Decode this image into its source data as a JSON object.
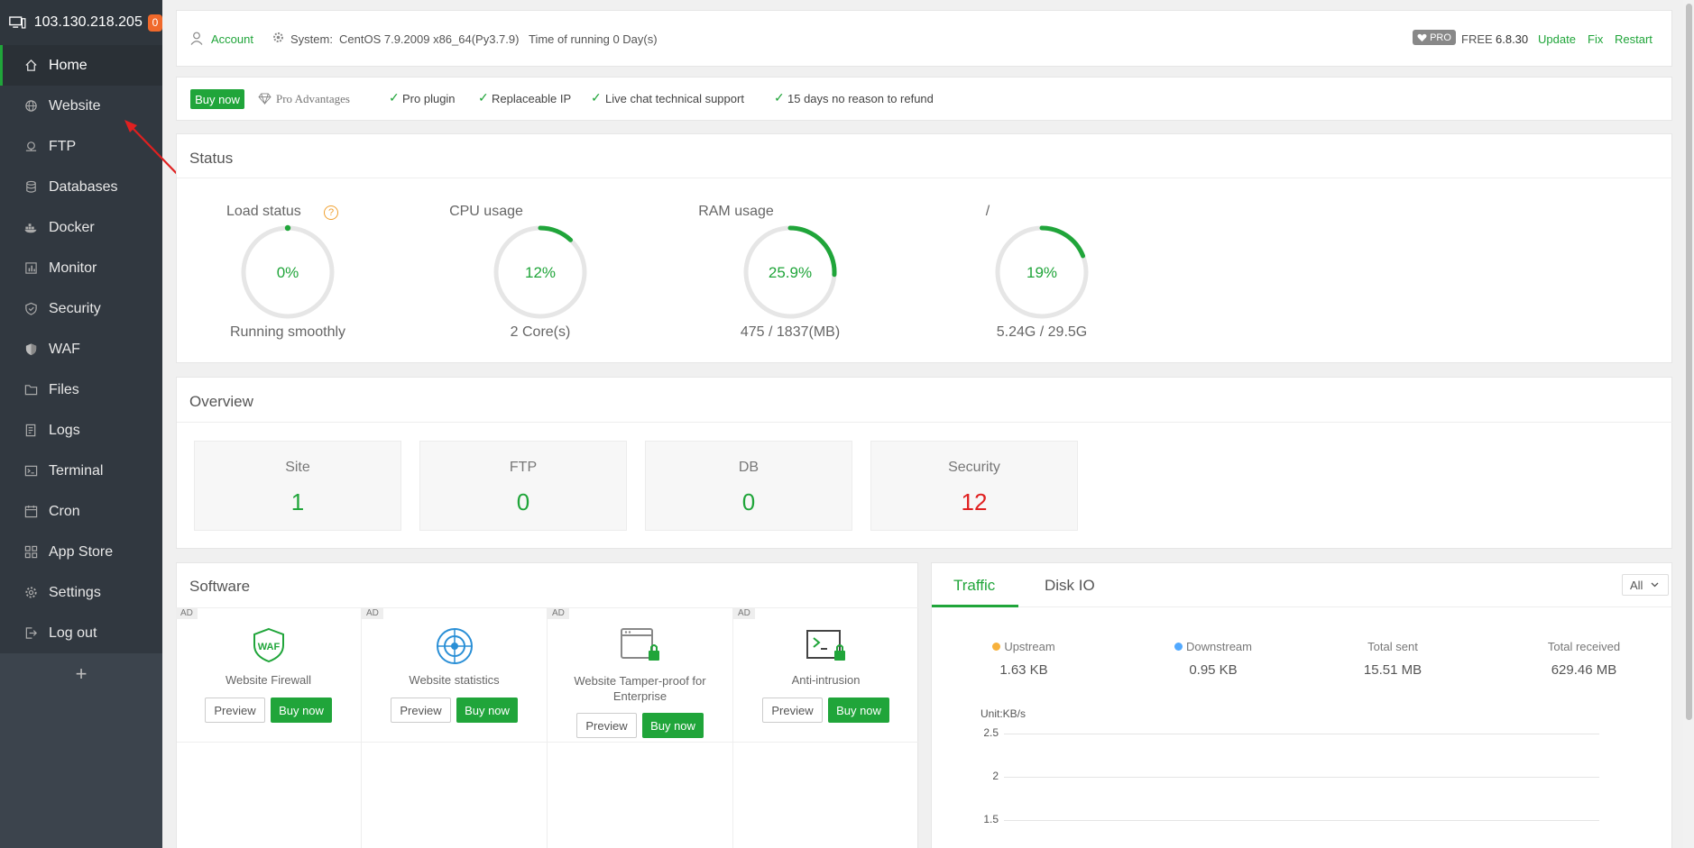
{
  "sidebar": {
    "ip": "103.130.218.205",
    "badge": "0",
    "items": [
      {
        "label": "Home",
        "icon": "home-icon"
      },
      {
        "label": "Website",
        "icon": "globe-icon"
      },
      {
        "label": "FTP",
        "icon": "ftp-icon"
      },
      {
        "label": "Databases",
        "icon": "database-icon"
      },
      {
        "label": "Docker",
        "icon": "docker-icon"
      },
      {
        "label": "Monitor",
        "icon": "monitor-icon"
      },
      {
        "label": "Security",
        "icon": "shield-icon"
      },
      {
        "label": "WAF",
        "icon": "waf-shield-icon"
      },
      {
        "label": "Files",
        "icon": "folder-icon"
      },
      {
        "label": "Logs",
        "icon": "logs-icon"
      },
      {
        "label": "Terminal",
        "icon": "terminal-icon"
      },
      {
        "label": "Cron",
        "icon": "calendar-icon"
      },
      {
        "label": "App Store",
        "icon": "grid-icon"
      },
      {
        "label": "Settings",
        "icon": "gear-icon"
      },
      {
        "label": "Log out",
        "icon": "logout-icon"
      }
    ],
    "plus": "+"
  },
  "topbar": {
    "account": "Account",
    "system_label": "System:",
    "system_value": "CentOS 7.9.2009 x86_64(Py3.7.9)",
    "running_time": "Time of running 0 Day(s)",
    "pro_badge": "PRO",
    "edition": "FREE",
    "version": "6.8.30",
    "update": "Update",
    "fix": "Fix",
    "restart": "Restart"
  },
  "promo": {
    "buy_now": "Buy now",
    "pro_advantages": "Pro Advantages",
    "features": [
      "Pro plugin",
      "Replaceable IP",
      "Live chat technical support",
      "15 days no reason to refund"
    ]
  },
  "status": {
    "title": "Status",
    "gauges": [
      {
        "label": "Load status",
        "value_text": "0%",
        "percent": 0,
        "sub": "Running smoothly",
        "has_help": true
      },
      {
        "label": "CPU usage",
        "value_text": "12%",
        "percent": 12,
        "sub": "2 Core(s)"
      },
      {
        "label": "RAM usage",
        "value_text": "25.9%",
        "percent": 25.9,
        "sub": "475 / 1837(MB)"
      },
      {
        "label": "/",
        "value_text": "19%",
        "percent": 19,
        "sub": "5.24G / 29.5G"
      }
    ],
    "help_mark": "?"
  },
  "overview": {
    "title": "Overview",
    "items": [
      {
        "label": "Site",
        "value": "1",
        "color": "#20a53a"
      },
      {
        "label": "FTP",
        "value": "0",
        "color": "#20a53a"
      },
      {
        "label": "DB",
        "value": "0",
        "color": "#20a53a"
      },
      {
        "label": "Security",
        "value": "12",
        "color": "#e02020"
      }
    ]
  },
  "software": {
    "title": "Software",
    "ad_label": "AD",
    "preview": "Preview",
    "buy": "Buy now",
    "items": [
      {
        "name": "Website Firewall",
        "icon": "waf-icon",
        "icon_text": "WAF"
      },
      {
        "name": "Website statistics",
        "icon": "statistics-icon"
      },
      {
        "name": "Website Tamper-proof for Enterprise",
        "icon": "tamper-proof-icon"
      },
      {
        "name": "Anti-intrusion",
        "icon": "anti-intrusion-icon"
      }
    ]
  },
  "traffic": {
    "tabs": [
      "Traffic",
      "Disk IO"
    ],
    "select_value": "All",
    "stats": [
      {
        "label": "Upstream",
        "value": "1.63 KB",
        "dot": "#f7b13c"
      },
      {
        "label": "Downstream",
        "value": "0.95 KB",
        "dot": "#52a9ff"
      },
      {
        "label": "Total sent",
        "value": "15.51 MB"
      },
      {
        "label": "Total received",
        "value": "629.46 MB"
      }
    ],
    "unit": "Unit:KB/s",
    "y_ticks": [
      "2.5",
      "2",
      "1.5"
    ]
  },
  "colors": {
    "accent": "#20a53a",
    "danger": "#e02020",
    "sidebar": "#3c444d"
  }
}
